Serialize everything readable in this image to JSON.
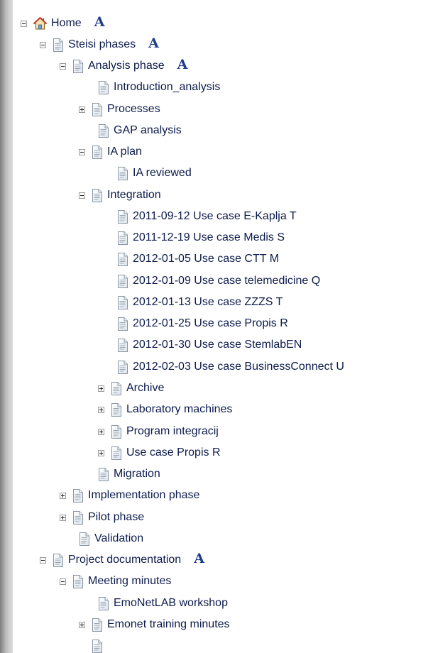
{
  "tree": {
    "home": {
      "label": "Home",
      "mark": "A"
    },
    "steisi": {
      "label": "Steisi phases",
      "mark": "A"
    },
    "analysis": {
      "label": "Analysis phase",
      "mark": "A"
    },
    "introduction": {
      "label": "Introduction_analysis"
    },
    "processes": {
      "label": "Processes"
    },
    "gap": {
      "label": "GAP analysis"
    },
    "ia_plan": {
      "label": "IA plan"
    },
    "ia_reviewed": {
      "label": "IA reviewed"
    },
    "integration": {
      "label": "Integration"
    },
    "use_cases": [
      {
        "label": "2011-09-12 Use case E-Kaplja T"
      },
      {
        "label": "2011-12-19 Use case Medis S"
      },
      {
        "label": "2012-01-05 Use case CTT M"
      },
      {
        "label": "2012-01-09 Use case telemedicine Q"
      },
      {
        "label": "2012-01-13 Use case ZZZS T"
      },
      {
        "label": "2012-01-25 Use case Propis R"
      },
      {
        "label": "2012-01-30 Use case StemlabEN"
      },
      {
        "label": "2012-02-03 Use case BusinessConnect U"
      }
    ],
    "archive": {
      "label": "Archive"
    },
    "lab_machines": {
      "label": "Laboratory machines"
    },
    "program": {
      "label": "Program integracij"
    },
    "propis": {
      "label": "Use case Propis R"
    },
    "migration": {
      "label": "Migration"
    },
    "implementation": {
      "label": "Implementation phase"
    },
    "pilot": {
      "label": "Pilot phase"
    },
    "validation": {
      "label": "Validation"
    },
    "project_doc": {
      "label": "Project documentation",
      "mark": "A"
    },
    "meeting": {
      "label": "Meeting minutes"
    },
    "emonetlab": {
      "label": "EmoNetLAB workshop"
    },
    "emonet_training": {
      "label": "Emonet training minutes"
    }
  },
  "colors": {
    "text": "#0d1b4c",
    "mark": "#1f3c8c"
  },
  "icons": {
    "page": "document-icon",
    "home": "home-icon"
  }
}
